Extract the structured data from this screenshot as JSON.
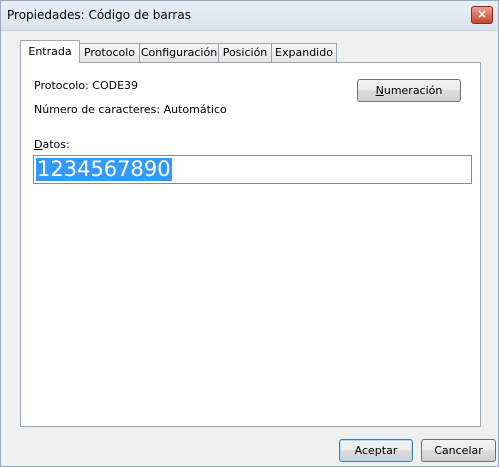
{
  "window": {
    "title": "Propiedades: Código de barras",
    "close_glyph": "×"
  },
  "tabs": [
    {
      "label": "Entrada",
      "active": true
    },
    {
      "label": "Protocolo",
      "active": false
    },
    {
      "label": "Configuración",
      "active": false
    },
    {
      "label": "Posición",
      "active": false
    },
    {
      "label": "Expandido",
      "active": false
    }
  ],
  "entrada": {
    "protocol_text": "Protocolo: CODE39",
    "chars_text": "Número de caracteres: Automático",
    "numeracion_first": "N",
    "numeracion_rest": "umeración",
    "datos_first": "D",
    "datos_rest": "atos:",
    "datos_value": "1234567890"
  },
  "footer": {
    "accept_label": "Aceptar",
    "cancel_label": "Cancelar"
  },
  "colors": {
    "selection": "#3399ff",
    "close_button": "#c8452d"
  }
}
